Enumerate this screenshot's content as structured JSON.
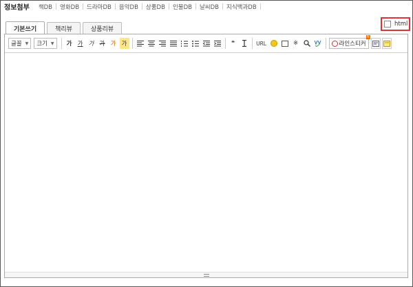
{
  "dbnav": {
    "title": "정보첨부",
    "items": [
      "책DB",
      "영화DB",
      "드라마DB",
      "음악DB",
      "상품DB",
      "인물DB",
      "날씨DB",
      "지식백과DB"
    ]
  },
  "html_toggle": {
    "label": "html",
    "checked": false,
    "highlight_color": "#d33333"
  },
  "tabs": [
    {
      "label": "기본쓰기",
      "active": true
    },
    {
      "label": "책리뷰",
      "active": false
    },
    {
      "label": "상품리뷰",
      "active": false
    }
  ],
  "toolbar": {
    "font_label": "글꼴",
    "size_label": "크기",
    "bold": "가",
    "underline": "가",
    "italic": "가",
    "strike": "가",
    "text_color": "가",
    "bg_color": "가",
    "url": "URL",
    "lineissticker": "라인스티커",
    "new_badge": "N"
  }
}
